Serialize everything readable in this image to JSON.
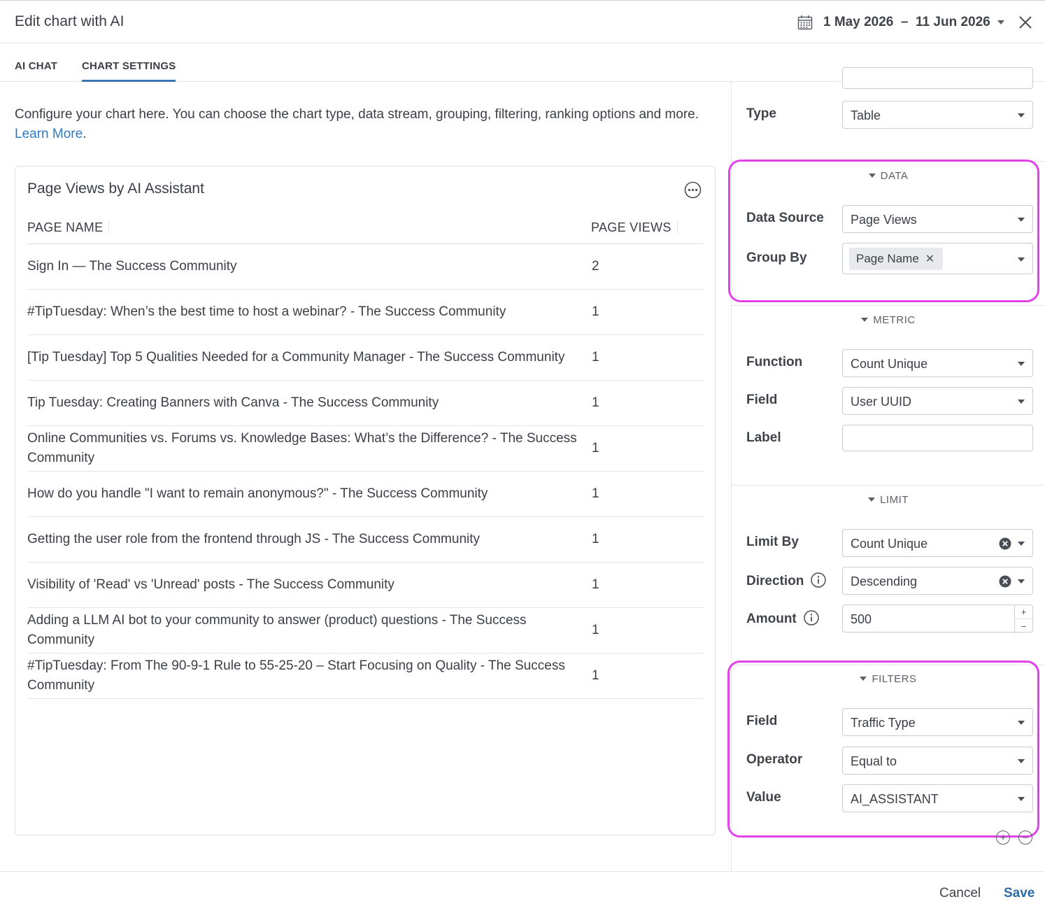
{
  "header": {
    "title": "Edit chart with AI",
    "date_range": "1 May 2026  –  11 Jun 2026"
  },
  "tabs": [
    {
      "label": "AI CHAT",
      "active": false
    },
    {
      "label": "CHART SETTINGS",
      "active": true
    }
  ],
  "intro": {
    "text": "Configure your chart here. You can choose the chart type, data stream, grouping, filtering, ranking options and more. ",
    "link": "Learn More",
    "after_link": "."
  },
  "chart": {
    "title": "Page Views by AI Assistant",
    "columns": [
      "PAGE NAME",
      "PAGE VIEWS"
    ],
    "rows": [
      {
        "name": "Sign In — The Success Community",
        "views": "2"
      },
      {
        "name": "#TipTuesday: When’s the best time to host a webinar? - The Success Community",
        "views": "1"
      },
      {
        "name": "[Tip Tuesday] Top 5 Qualities Needed for a Community Manager - The Success Community",
        "views": "1"
      },
      {
        "name": "Tip Tuesday: Creating Banners with Canva - The Success Community",
        "views": "1"
      },
      {
        "name": "Online Communities vs. Forums vs. Knowledge Bases: What’s the Difference? - The Success Community",
        "views": "1"
      },
      {
        "name": "How do you handle \"I want to remain anonymous?\" - The Success Community",
        "views": "1"
      },
      {
        "name": "Getting the user role from the frontend through JS - The Success Community",
        "views": "1"
      },
      {
        "name": "Visibility of 'Read' vs 'Unread' posts - The Success Community",
        "views": "1"
      },
      {
        "name": "Adding a LLM AI bot to your community to answer (product) questions - The Success Community",
        "views": "1"
      },
      {
        "name": "#TipTuesday: From The 90-9-1 Rule to 55-25-20 – Start Focusing on Quality - The Success Community",
        "views": "1"
      }
    ]
  },
  "settings": {
    "type": {
      "label": "Type",
      "value": "Table"
    },
    "data": {
      "heading": "DATA",
      "source_label": "Data Source",
      "source_value": "Page Views",
      "group_label": "Group By",
      "group_chip": "Page Name"
    },
    "metric": {
      "heading": "METRIC",
      "function_label": "Function",
      "function_value": "Count Unique",
      "field_label": "Field",
      "field_value": "User UUID",
      "label_label": "Label",
      "label_value": ""
    },
    "limit": {
      "heading": "LIMIT",
      "by_label": "Limit By",
      "by_value": "Count Unique",
      "direction_label": "Direction",
      "direction_value": "Descending",
      "amount_label": "Amount",
      "amount_value": "500"
    },
    "filters": {
      "heading": "FILTERS",
      "field_label": "Field",
      "field_value": "Traffic Type",
      "operator_label": "Operator",
      "operator_value": "Equal to",
      "value_label": "Value",
      "value_value": "AI_ASSISTANT"
    },
    "add_symbol": "+",
    "remove_symbol": "−"
  },
  "footer": {
    "cancel": "Cancel",
    "save": "Save"
  },
  "colors": {
    "accent": "#2d6aa6",
    "highlight": "#e044e8",
    "link": "#2f7bc4"
  }
}
